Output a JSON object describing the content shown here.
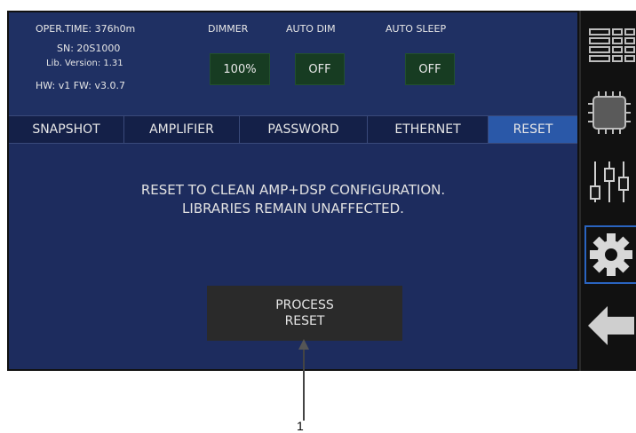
{
  "info": {
    "oper_time": "OPER.TIME: 376h0m",
    "sn": "SN: 20S1000",
    "lib_version": "Lib. Version: 1.31",
    "hw_fw": "HW: v1  FW: v3.0.7"
  },
  "controls": {
    "dimmer": {
      "label": "DIMMER",
      "value": "100%"
    },
    "auto_dim": {
      "label": "AUTO DIM",
      "value": "OFF"
    },
    "auto_sleep": {
      "label": "AUTO SLEEP",
      "value": "OFF"
    }
  },
  "tabs": [
    {
      "label": "SNAPSHOT"
    },
    {
      "label": "AMPLIFIER"
    },
    {
      "label": "PASSWORD"
    },
    {
      "label": "ETHERNET"
    },
    {
      "label": "RESET",
      "active": true
    }
  ],
  "content": {
    "message": "RESET TO CLEAN AMP+DSP CONFIGURATION.\nLIBRARIES REMAIN UNAFFECTED.",
    "process_button": "PROCESS\nRESET"
  },
  "sidebar": {
    "items": [
      {
        "icon": "channel-list-icon"
      },
      {
        "icon": "amplifier-chip-icon"
      },
      {
        "icon": "faders-icon"
      },
      {
        "icon": "gear-icon",
        "selected": true
      },
      {
        "icon": "back-arrow-icon"
      }
    ]
  },
  "callout": {
    "number": "1"
  },
  "colors": {
    "panel": "#1d2c5e",
    "active_tab": "#2a58a8",
    "value_box": "#173c22",
    "button": "#2a2a2a"
  }
}
